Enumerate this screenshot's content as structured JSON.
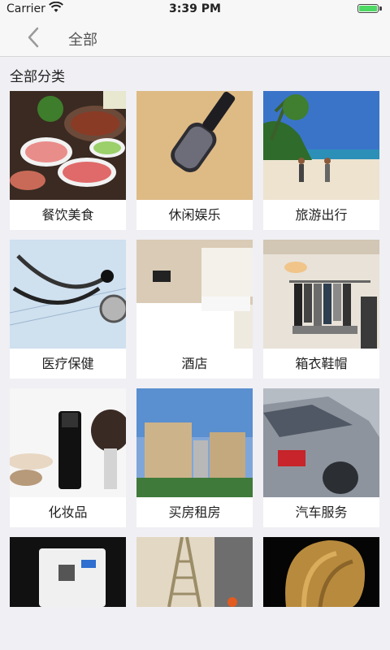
{
  "status": {
    "carrier": "Carrier",
    "time": "3:39 PM"
  },
  "nav": {
    "title": "全部"
  },
  "section_title": "全部分类",
  "categories": [
    {
      "label": "餐饮美食",
      "icon": "hotpot-food-photo"
    },
    {
      "label": "休闲娱乐",
      "icon": "microphone-photo"
    },
    {
      "label": "旅游出行",
      "icon": "beach-travel-photo"
    },
    {
      "label": "医疗保健",
      "icon": "stethoscope-photo"
    },
    {
      "label": "酒店",
      "icon": "hotel-room-photo"
    },
    {
      "label": "箱衣鞋帽",
      "icon": "clothing-store-photo"
    },
    {
      "label": "化妆品",
      "icon": "makeup-brush-photo"
    },
    {
      "label": "买房租房",
      "icon": "apartment-building-photo"
    },
    {
      "label": "汽车服务",
      "icon": "car-wash-photo"
    },
    {
      "label": "",
      "icon": "circuit-breaker-photo"
    },
    {
      "label": "",
      "icon": "ladder-photo"
    },
    {
      "label": "",
      "icon": "hair-salon-photo"
    }
  ],
  "colors": {
    "background": "#efeff4",
    "card": "#ffffff",
    "battery": "#4cd964"
  }
}
